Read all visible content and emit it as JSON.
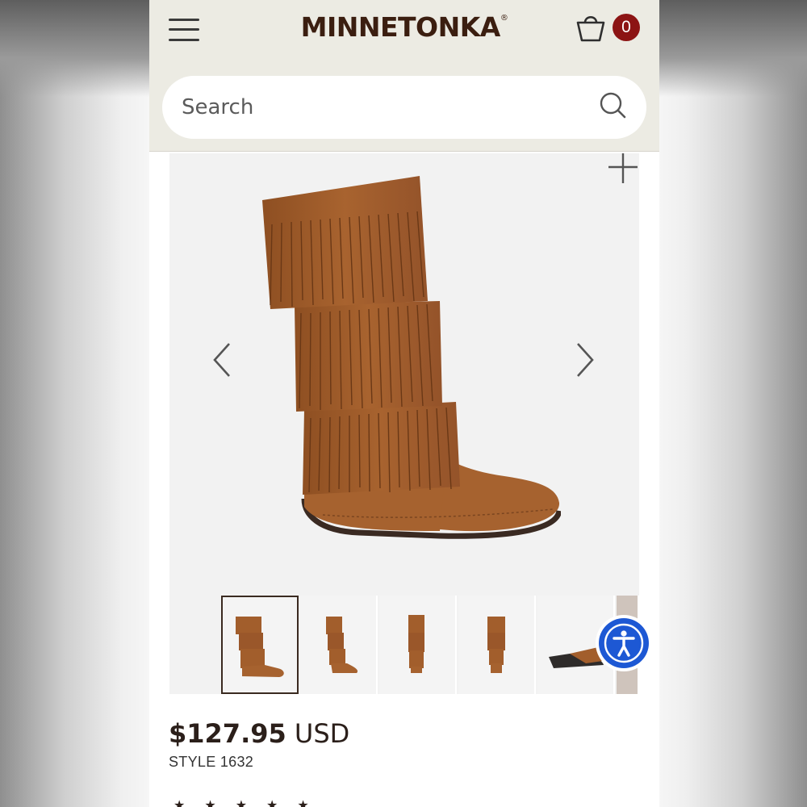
{
  "header": {
    "brand": "MINNETONKA",
    "brand_mark": "®",
    "cart_count": "0"
  },
  "search": {
    "placeholder": "Search"
  },
  "product": {
    "price_amount": "$127.95",
    "price_currency": "USD",
    "style": "STYLE 1632",
    "rating_stars": "★★★★★"
  },
  "gallery": {
    "thumbnail_count": 6,
    "active_thumbnail": 1
  },
  "colors": {
    "header_bg": "#ecebe3",
    "brand": "#3b1e10",
    "badge": "#8c1414",
    "suede": "#a25e2c",
    "accessibility": "#1d58d4"
  },
  "icons": [
    "hamburger-menu-icon",
    "shopping-bag-icon",
    "search-icon",
    "zoom-plus-icon",
    "chevron-left-icon",
    "chevron-right-icon",
    "accessibility-icon"
  ]
}
